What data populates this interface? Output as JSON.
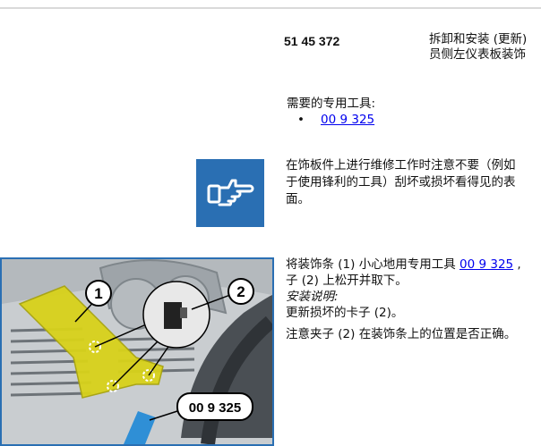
{
  "header": {
    "doc_number": "51 45 372",
    "title_line1": "拆卸和安装 (更新)",
    "title_line2": "员侧左仪表板装饰"
  },
  "tools": {
    "heading": "需要的专用工具:",
    "items": [
      {
        "bullet": "•",
        "label": "00 9 325"
      }
    ]
  },
  "note": {
    "icon": "hand-pointing-icon",
    "line1": "在饰板件上进行维修工作时注意不要（例如",
    "line2": "于使用锋利的工具）刮坏或损坏看得见的表",
    "line3": "面。"
  },
  "figure": {
    "callout1": "1",
    "callout2": "2",
    "tool_label": "00 9 325"
  },
  "steps": {
    "line1_prefix": "将装饰条 (1) 小心地用专用工具 ",
    "line1_link": "00 9 325",
    "line1_suffix": " ,",
    "line2": "子 (2) 上松开并取下。",
    "install_heading": "安装说明:",
    "line3": "更新损坏的卡子 (2)。",
    "line4": "注意夹子 (2) 在装饰条上的位置是否正确。"
  },
  "colors": {
    "icon_bg": "#2a6fb3",
    "link": "#0000ee",
    "trim_highlight": "#d8d21a",
    "tool_blue": "#2f8fd6"
  }
}
